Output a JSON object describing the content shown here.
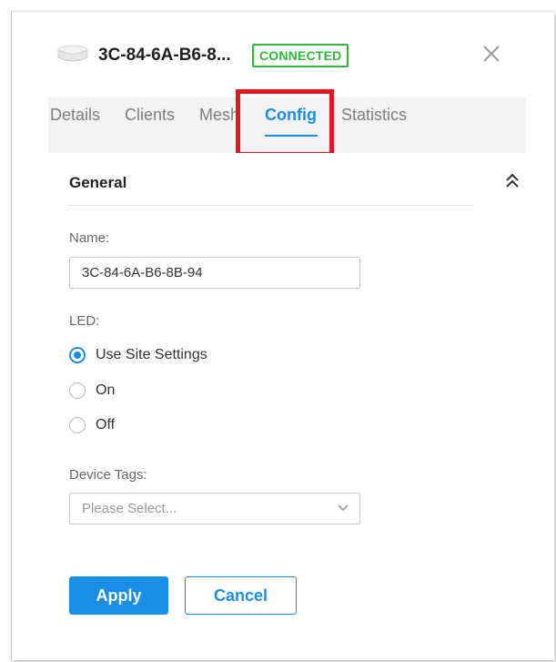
{
  "device": {
    "name": "3C-84-6A-B6-8...",
    "status": "CONNECTED",
    "status_color": "#2fb83a"
  },
  "tabs": [
    {
      "label": "Details"
    },
    {
      "label": "Clients"
    },
    {
      "label": "Mesh"
    },
    {
      "label": "Config",
      "active": true
    },
    {
      "label": "Statistics"
    }
  ],
  "general": {
    "title": "General",
    "name_label": "Name:",
    "name_value": "3C-84-6A-B6-8B-94",
    "led_label": "LED:",
    "led_options": [
      {
        "label": "Use Site Settings",
        "checked": true
      },
      {
        "label": "On",
        "checked": false
      },
      {
        "label": "Off",
        "checked": false
      }
    ],
    "tags_label": "Device Tags:",
    "tags_placeholder": "Please Select..."
  },
  "actions": {
    "apply_label": "Apply",
    "cancel_label": "Cancel"
  },
  "colors": {
    "accent": "#1a8ee6",
    "highlight": "#e8141b"
  },
  "icons": {
    "device": "access-point-icon",
    "close": "close-icon",
    "collapse": "double-chevron-up-icon",
    "dropdown": "chevron-down-icon"
  }
}
